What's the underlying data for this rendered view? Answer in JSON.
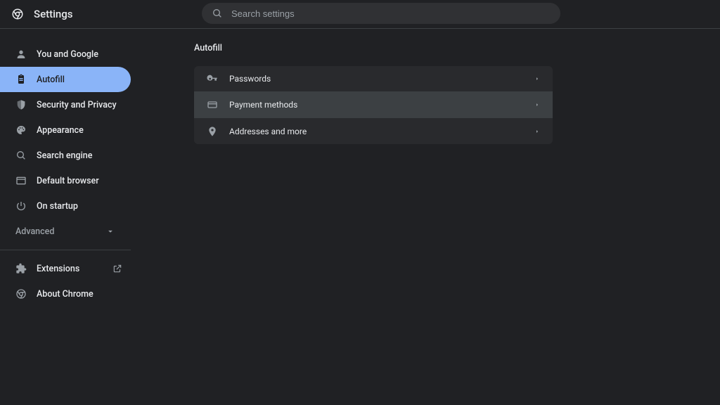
{
  "header": {
    "title": "Settings"
  },
  "search": {
    "placeholder": "Search settings"
  },
  "sidebar": {
    "items": [
      {
        "label": "You and Google"
      },
      {
        "label": "Autofill"
      },
      {
        "label": "Security and Privacy"
      },
      {
        "label": "Appearance"
      },
      {
        "label": "Search engine"
      },
      {
        "label": "Default browser"
      },
      {
        "label": "On startup"
      }
    ],
    "advanced": "Advanced",
    "footer": [
      {
        "label": "Extensions"
      },
      {
        "label": "About Chrome"
      }
    ]
  },
  "section": {
    "title": "Autofill",
    "rows": [
      {
        "label": "Passwords"
      },
      {
        "label": "Payment methods"
      },
      {
        "label": "Addresses and more"
      }
    ]
  }
}
